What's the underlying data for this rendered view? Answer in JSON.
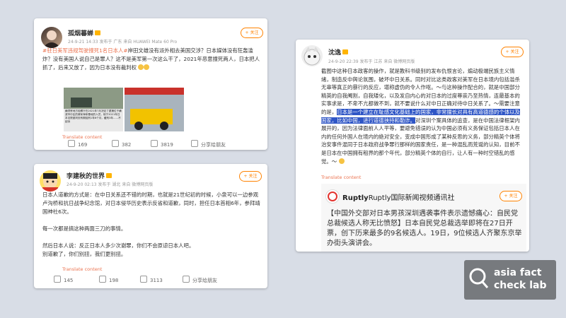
{
  "post1": {
    "username": "孤烟暮蝉",
    "meta": "24-9-21 14:33  发布于 广东  来自 HUAWEI Mate 60 Pro",
    "follow": "+ 关注",
    "hashtag": "#驻日美军违规驾驶撞死1名日本人#",
    "body": "岸田文雄没有派外相去美国交涉？日本媒体没有狂轰滥炸？没有美国人说自己是罪人？这不是美军第一次这么干了，2021年恶意撞死两人，日本把人抓了，后来又放了，因为日本没有裁判权",
    "image1_caption": "横须贺地方检察厅在2021年7月决定了逮捕位于横滨市中区的美军海军基地的人员，他于2021年日本法院被判处有期徒刑1年6个月，缓刑3年……不起诉",
    "translate": "Translate content",
    "actions": [
      "169",
      "382",
      "3819",
      "分享给朋友"
    ]
  },
  "post2": {
    "username": "李建秋的世界",
    "meta": "24-9-20 02:13  发布于 湖北  来自 微博网页版",
    "follow": "+ 关注",
    "para1": "日本人道歉的方式是：在中日关系还不错的时期，也就是21世纪初的时候，小泉可以一边参观卢沟桥和抗日战争纪念馆，对日本侵华历史表示反省和道歉，同时，担任日本首相6年，参拜靖国神社6次。",
    "para2": "每一次都是搞这种两面三刀的事情。",
    "para3": "然后日本人说：反正日本人多少次谢罪，你们不会原谅日本人吧。",
    "para4": "别道歉了，你们别扭，我们更别扭。",
    "translate": "Translate content",
    "actions": [
      "145",
      "198",
      "3113",
      "分享给朋友"
    ]
  },
  "post3": {
    "username": "沈逸",
    "meta": "24-9-20 22:39  发布于 江苏  来自 微博网页版",
    "follow": "+ 关注",
    "body_pre": "截图中这种日本政客的操作，就是教科书级别的发布仇恨言论，煽动极端民族主义情绪，制造反中舆论氛围，破坏中日关系。同时对比这类政客对美军在日本境内包括滥杀无辜等真正的暴行的反应，堪称虚伪的令人作呕。～与这种操作配合的，就是中国部分精英的自我阉割，自我矮化，以及发自内心的对日本的过度尊崇乃至热情，连最基本的实事求是，不卑不亢都做不到，就不要说什么对中日正确对待中日关系了。～需要注意的是，",
    "body_hl": "日本是一个建立在耻感文化基础上的国家，非常擅长对具有高道德感的个体以及国家，比如中国，进行道德挟持和勒诈。",
    "body_post": "对深圳个案具体的追查，是在中国法律框架内展开的，因为法律面前人人平等，要避免错误的认为中国必须有义务保证包括日本人在内的任何外国人在境内的绝对安全，变成中国形成了某种反思的义务，部分精英个体将治安事件混同于日本政府战争罪行那样的国家责任，是一种混乱而荒诞的认知，目前不是日本在中国拥有租界的那个年代，部分精英个体的自行，让人有一种时空错乱的感觉。～",
    "translate": "Translate content",
    "repost": {
      "username": "Ruptly国际新闻视频通讯社",
      "logo_text": "Ruptly",
      "follow": "+ 关注",
      "body": "【中国外交部对日本男孩深圳遇袭事件表示遗憾痛心：自民党总裁候选人称无比愤怒】日本自民党总裁选举即将在27日开票，创下历来最多的9名候选人。19日，9位候选人齐聚东京举办街头演讲会。"
    }
  },
  "watermark": {
    "line1": "asia fact",
    "line2": "check lab"
  }
}
